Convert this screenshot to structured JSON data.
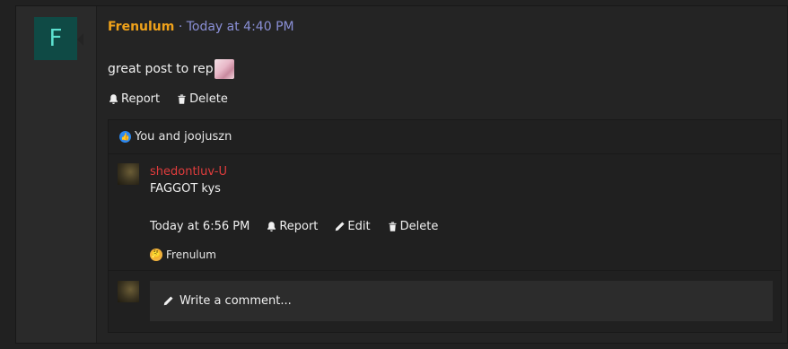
{
  "post": {
    "avatar_letter": "F",
    "author": "Frenulum",
    "separator": "·",
    "timestamp": "Today at 4:40 PM",
    "body": "great post to rep",
    "actions": {
      "report": "Report",
      "delete": "Delete"
    }
  },
  "likes": {
    "text": "You and joojuszn"
  },
  "reply": {
    "author": "shedontluv-U",
    "text": "FAGGOT kys",
    "timestamp": "Today at 6:56 PM",
    "actions": {
      "report": "Report",
      "edit": "Edit",
      "delete": "Delete"
    },
    "reaction_user": "Frenulum"
  },
  "composer": {
    "placeholder": "Write a comment..."
  },
  "colors": {
    "author": "#f0a21a",
    "timestamp": "#8a8fd6",
    "reply_author": "#e03c3c",
    "avatar_bg": "#0f4a45",
    "like": "#2b88f0"
  },
  "icons": [
    "bell-icon",
    "trash-icon",
    "thumbs-up-icon",
    "pencil-icon",
    "reaction-face-icon"
  ]
}
